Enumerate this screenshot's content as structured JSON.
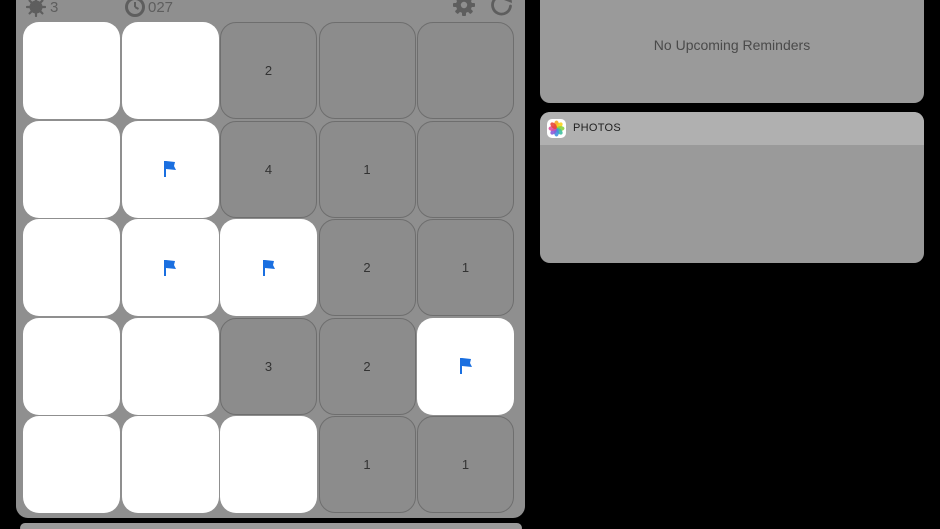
{
  "game": {
    "mine_count": "3",
    "timer": "027",
    "settings_icon": "gear-icon",
    "restart_icon": "restart-icon",
    "board": {
      "rows": 5,
      "cols": 5,
      "cells": [
        [
          {
            "state": "hidden",
            "text": ""
          },
          {
            "state": "hidden",
            "text": ""
          },
          {
            "state": "revealed",
            "text": "2"
          },
          {
            "state": "revealed",
            "text": ""
          },
          {
            "state": "revealed",
            "text": ""
          }
        ],
        [
          {
            "state": "hidden",
            "text": ""
          },
          {
            "state": "flagged",
            "text": ""
          },
          {
            "state": "revealed",
            "text": "4"
          },
          {
            "state": "revealed",
            "text": "1"
          },
          {
            "state": "revealed",
            "text": ""
          }
        ],
        [
          {
            "state": "hidden",
            "text": ""
          },
          {
            "state": "flagged",
            "text": ""
          },
          {
            "state": "flagged",
            "text": ""
          },
          {
            "state": "revealed",
            "text": "2"
          },
          {
            "state": "revealed",
            "text": "1"
          }
        ],
        [
          {
            "state": "hidden",
            "text": ""
          },
          {
            "state": "hidden",
            "text": ""
          },
          {
            "state": "revealed",
            "text": "3"
          },
          {
            "state": "revealed",
            "text": "2"
          },
          {
            "state": "flagged",
            "text": ""
          }
        ],
        [
          {
            "state": "hidden",
            "text": ""
          },
          {
            "state": "hidden",
            "text": ""
          },
          {
            "state": "hidden",
            "text": ""
          },
          {
            "state": "revealed",
            "text": "1"
          },
          {
            "state": "revealed",
            "text": "1"
          }
        ]
      ]
    },
    "colors": {
      "flag": "#1a6fe0",
      "hidden_cell": "#ffffff",
      "revealed_cell": "#8c8c8c"
    }
  },
  "reminders": {
    "empty_text": "No Upcoming Reminders"
  },
  "photos": {
    "title": "PHOTOS",
    "icon": "photos-app-icon"
  }
}
